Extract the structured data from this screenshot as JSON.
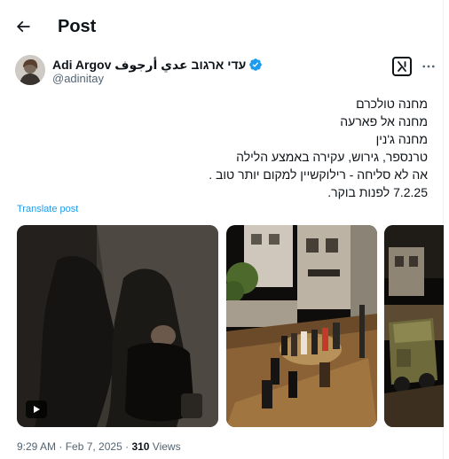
{
  "header": {
    "title": "Post",
    "back_icon": "arrow-left-icon"
  },
  "author": {
    "display_name": "עדי ארגוב عدي أرجوف Adi Argov",
    "handle": "@adinitay",
    "verified_icon": "verified-badge-icon",
    "verified_color": "#1d9bf0"
  },
  "actions": {
    "grok_icon": "grok-icon",
    "more_icon": "more-horizontal-icon"
  },
  "tweet": {
    "lines": [
      "מחנה טולכרם",
      "מחנה אל פארעה",
      "מחנה ג'נין",
      "טרנספר, גירוש, עקירה באמצע הלילה",
      "אה לא סליחה - רילוקשיין  למקום יותר טוב .",
      "7.2.25 לפנות בוקר."
    ],
    "translate": "Translate post"
  },
  "media": [
    {
      "kind": "video",
      "play_icon": "play-icon"
    },
    {
      "kind": "photo"
    },
    {
      "kind": "photo"
    }
  ],
  "meta": {
    "time": "9:29 AM",
    "separator": " · ",
    "date": "Feb 7, 2025",
    "views_count": "310",
    "views_label": " Views"
  },
  "colors": {
    "accent": "#1d9bf0",
    "text": "#0f1419",
    "secondary": "#536471"
  }
}
